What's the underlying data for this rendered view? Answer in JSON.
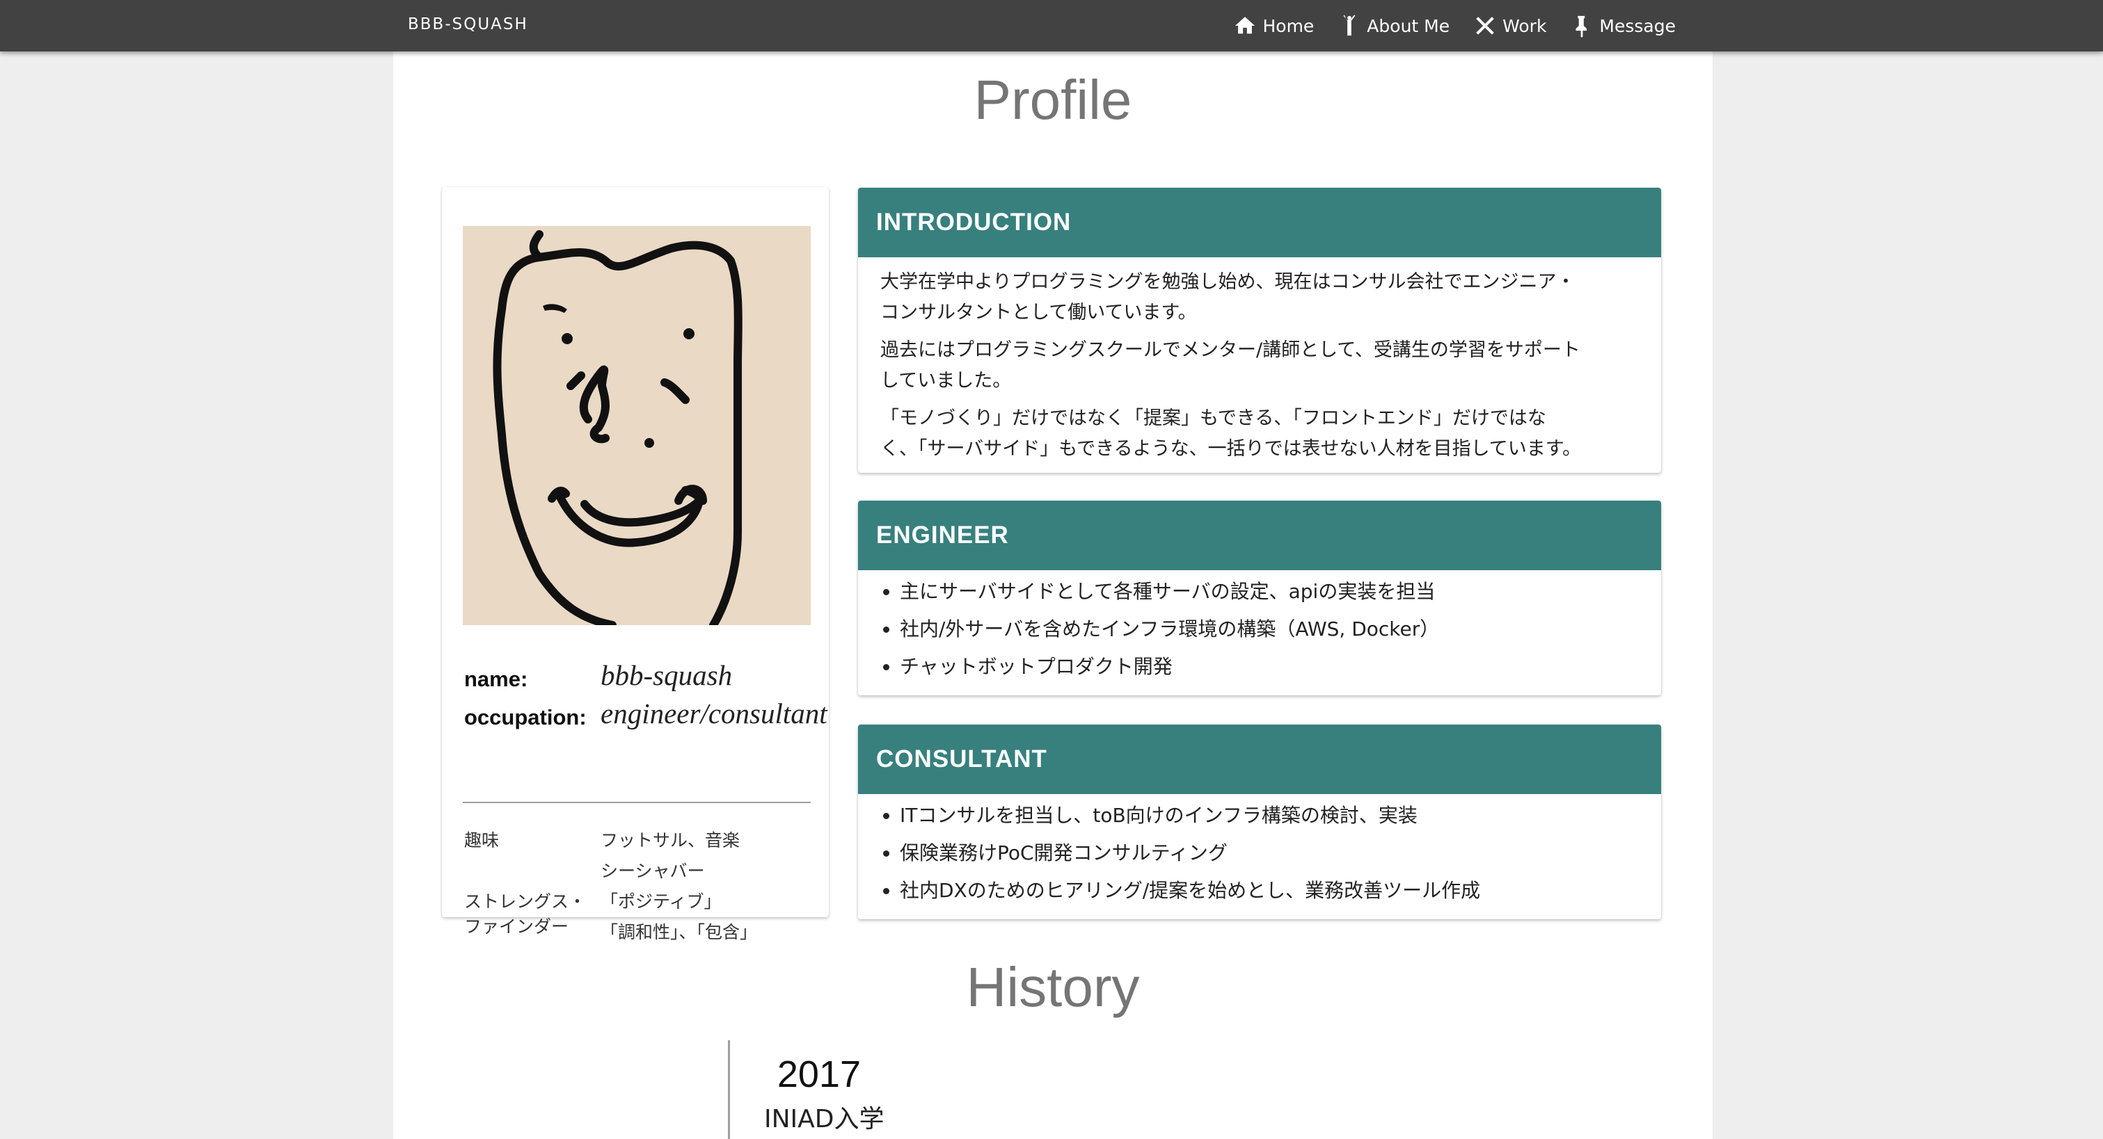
{
  "navbar": {
    "brand": "BBB-SQUASH",
    "items": [
      {
        "label": "Home",
        "icon": "home-icon"
      },
      {
        "label": "About Me",
        "icon": "person-icon"
      },
      {
        "label": "Work",
        "icon": "tools-icon"
      },
      {
        "label": "Message",
        "icon": "pin-icon"
      }
    ]
  },
  "profile": {
    "title": "Profile",
    "name_label": "name:",
    "name_value": "bbb-squash",
    "occupation_label": "occupation:",
    "occupation_value": "engineer/consultant",
    "hobby_label": "趣味",
    "hobby_value": "フットサル、音楽",
    "strengths_label_1": "ストレングス・",
    "strengths_label_2": "ファインダー",
    "strengths_values": [
      "シーシャバー",
      "「ポジティブ」",
      "「調和性」、「包含」"
    ]
  },
  "cards": {
    "introduction": {
      "title": "INTRODUCTION",
      "paragraphs": [
        [
          "大学在学中よりプログラミングを勉強し始め、現在はコンサル会社でエンジニア・",
          "コンサルタントとして働いています。"
        ],
        [
          "過去にはプログラミングスクールでメンター/講師として、受講生の学習をサポート",
          "していました。"
        ],
        [
          "「モノづくり」だけではなく「提案」もできる、「フロントエンド」だけではな",
          "く、「サーバサイド」もできるような、一括りでは表せない人材を目指しています。"
        ]
      ]
    },
    "engineer": {
      "title": "ENGINEER",
      "items": [
        "主にサーバサイドとして各種サーバの設定、apiの実装を担当",
        "社内/外サーバを含めたインフラ環境の構築（AWS, Docker）",
        "チャットボットプロダクト開発"
      ]
    },
    "consultant": {
      "title": "CONSULTANT",
      "items": [
        "ITコンサルを担当し、toB向けのインフラ構築の検討、実装",
        "保険業務けPoC開発コンサルティング",
        "社内DXのためのヒアリング/提案を始めとし、業務改善ツール作成"
      ]
    }
  },
  "history": {
    "title": "History",
    "entries": [
      {
        "year": "2017",
        "event": "INIAD入学"
      }
    ]
  },
  "colors": {
    "navbar": "#424242",
    "card_header": "#37807d",
    "page_bg": "#eeeeee",
    "title_text": "#757575"
  }
}
